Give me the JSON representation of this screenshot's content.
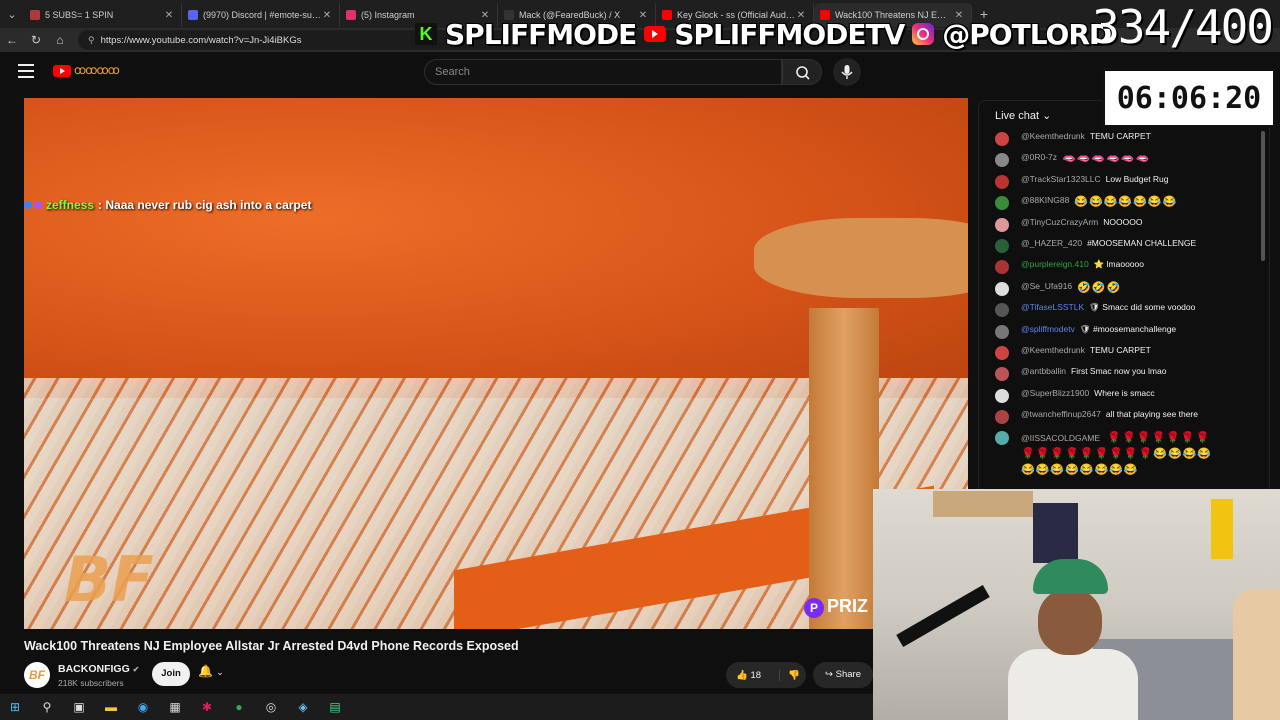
{
  "browser": {
    "tabs": [
      {
        "title": "5 SUBS= 1 SPIN",
        "favicon_color": "#b03a3a"
      },
      {
        "title": "(9970) Discord | #emote-submission",
        "favicon_color": "#5865f2"
      },
      {
        "title": "(5) Instagram",
        "favicon_color": "#e1306c"
      },
      {
        "title": "Mack (@FearedBuck) / X",
        "favicon_color": "#333333"
      },
      {
        "title": "Key Glock - ss (Official Audio)",
        "favicon_color": "#ff0000"
      },
      {
        "title": "Wack100 Threatens NJ Employee",
        "favicon_color": "#ff0000"
      }
    ],
    "url": "https://www.youtube.com/watch?v=Jn-Ji4iBKGs"
  },
  "youtube": {
    "search_placeholder": "Search",
    "doodle": "ꝏꝏꝏꝏ"
  },
  "overlay": {
    "handles": [
      "SPLIFFMODE",
      "SPLIFFMODETV",
      "@POTLORD"
    ],
    "counter": "334/400",
    "timer": "06:06:20",
    "chat_user": "zeffness",
    "chat_text": ": Naaa never rub cig ash into a carpet"
  },
  "video": {
    "title": "Wack100 Threatens NJ Employee Allstar Jr Arrested D4vd Phone Records Exposed",
    "channel": "BACKONFIGG",
    "subscribers": "218K subscribers",
    "join_label": "Join",
    "likes": "18",
    "share_label": "Share",
    "logo_text": "BF",
    "prize_text": "PRIZ",
    "avatar_text": "BF"
  },
  "chat": {
    "header": "Live chat",
    "messages": [
      {
        "user": "@Keemthedrunk",
        "text": "TEMU CARPET",
        "avatar": "#c44",
        "style": ""
      },
      {
        "user": "@0R0-7z",
        "text": "🫦🫦🫦🫦🫦🫦",
        "avatar": "#888",
        "style": ""
      },
      {
        "user": "@TrackStar1323LLC",
        "text": "Low Budget Rug",
        "avatar": "#b33",
        "style": ""
      },
      {
        "user": "@88KING88",
        "text": "😂😂😂😂😂😂😂",
        "avatar": "#3a8a3a",
        "style": ""
      },
      {
        "user": "@TinyCuzCrazyArm",
        "text": "NOOOOO",
        "avatar": "#d99",
        "style": ""
      },
      {
        "user": "@_HAZER_420",
        "text": "#MOOSEMAN CHALLENGE",
        "avatar": "#2b5f3a",
        "style": ""
      },
      {
        "user": "@purplereign.410",
        "text": "⭐ lmaooooo",
        "avatar": "#a33",
        "style": "green"
      },
      {
        "user": "@Se_Ufa916",
        "text": "🤣🤣🤣",
        "avatar": "#ddd",
        "style": ""
      },
      {
        "user": "@TifaseLSSTLK",
        "text": "🛡 Smacc did some voodoo",
        "avatar": "#555",
        "style": "mod"
      },
      {
        "user": "@spliffmodetv",
        "text": "🛡 #moosemanchallenge",
        "avatar": "#777",
        "style": "mod"
      },
      {
        "user": "@Keemthedrunk",
        "text": "TEMU CARPET",
        "avatar": "#c44",
        "style": ""
      },
      {
        "user": "@antbballin",
        "text": "First Smac now you lmao",
        "avatar": "#b55",
        "style": ""
      },
      {
        "user": "@SuperBlizz1900",
        "text": "Where is smacc",
        "avatar": "#ddd",
        "style": ""
      },
      {
        "user": "@twancheffinup2647",
        "text": "all that playing see there",
        "avatar": "#a44",
        "style": ""
      }
    ],
    "last_message": {
      "user": "@IISSACOLDGAME",
      "text": "🌹🌹🌹🌹🌹🌹🌹🌹🌹🌹🌹🌹🌹🌹🌹🌹😂😂😂😂😂😂😂😂😂😂😂😂",
      "avatar": "#5aa"
    }
  },
  "taskbar": {
    "icons": [
      "windows-start-icon",
      "search-icon",
      "task-view-icon",
      "file-explorer-icon",
      "edge-icon",
      "calendar-icon",
      "slack-icon",
      "chrome-icon",
      "obs-icon",
      "steam-icon",
      "app-icon"
    ]
  }
}
